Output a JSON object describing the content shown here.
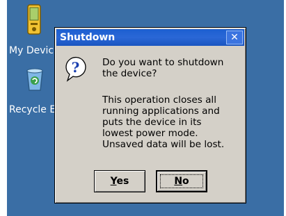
{
  "desktop": {
    "icons": [
      {
        "label": "My Devic",
        "icon": "pda-device-icon"
      },
      {
        "label": "Recycle E",
        "icon": "recycle-bin-icon"
      }
    ]
  },
  "dialog": {
    "title": "Shutdown",
    "close_label": "✕",
    "icon": "question-icon",
    "message": "Do you want to shutdown\nthe device?",
    "detail": "This operation closes all\nrunning applications and\nputs the device in its\nlowest power mode.\nUnsaved data will be lost.",
    "buttons": {
      "yes": {
        "accel": "Y",
        "rest": "es"
      },
      "no": {
        "accel": "N",
        "rest": "o"
      }
    }
  },
  "colors": {
    "desktop": "#3a6ea5",
    "titlebar": "#1c5fd1",
    "dialog_face": "#d4d0c8"
  }
}
